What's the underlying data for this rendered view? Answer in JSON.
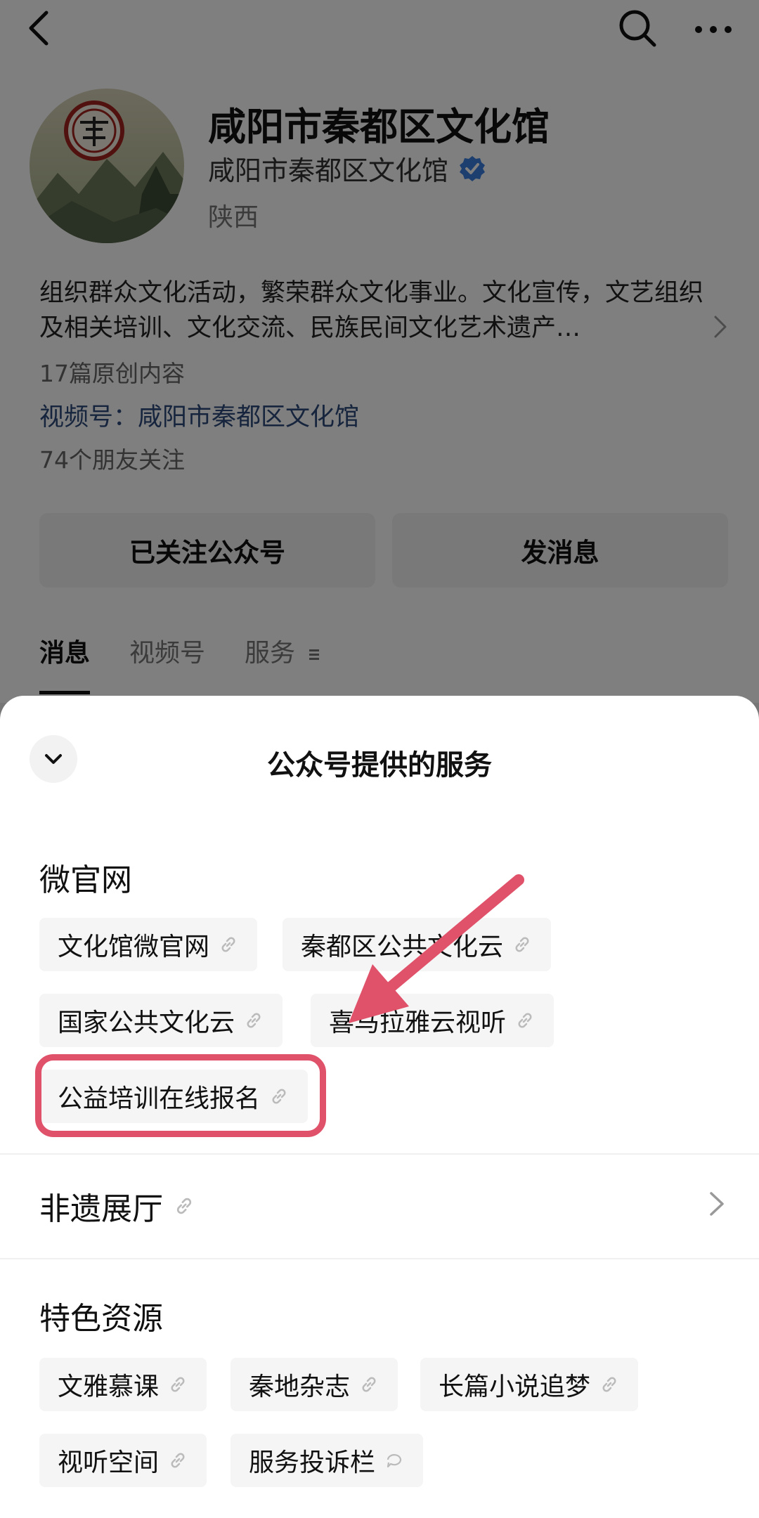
{
  "profile": {
    "name": "咸阳市秦都区文化馆",
    "sub_name": "咸阳市秦都区文化馆",
    "region": "陕西",
    "description": "组织群众文化活动，繁荣群众文化事业。文化宣传，文艺组织及相关培训、文化交流、民族民间文化艺术遗产…",
    "original_count": "17篇原创内容",
    "channel": "视频号：咸阳市秦都区文化馆",
    "friends_following": "74个朋友关注",
    "followed_button": "已关注公众号",
    "message_button": "发消息",
    "tabs": [
      "消息",
      "视频号",
      "服务"
    ],
    "active_tab": "消息"
  },
  "sheet": {
    "title": "公众号提供的服务",
    "sections": {
      "micro_site": {
        "title": "微官网",
        "items": [
          "文化馆微官网",
          "秦都区公共文化云",
          "国家公共文化云",
          "喜马拉雅云视听",
          "公益培训在线报名"
        ]
      },
      "heritage": {
        "title": "非遗展厅"
      },
      "resources": {
        "title": "特色资源",
        "items": [
          "文雅慕课",
          "秦地杂志",
          "长篇小说追梦",
          "视听空间",
          "服务投诉栏"
        ]
      }
    }
  },
  "icons": {
    "back": "chevron-left-icon",
    "search": "search-icon",
    "more": "more-icon",
    "verified": "verified-badge-icon",
    "link": "link-icon",
    "chat": "chat-bubble-icon",
    "collapse": "chevron-down-icon"
  },
  "colors": {
    "annotation": "#e0516a",
    "verified": "#3b7ee0",
    "channel_text": "#2c4a7a",
    "overlay": "rgba(0,0,0,0.5)"
  }
}
